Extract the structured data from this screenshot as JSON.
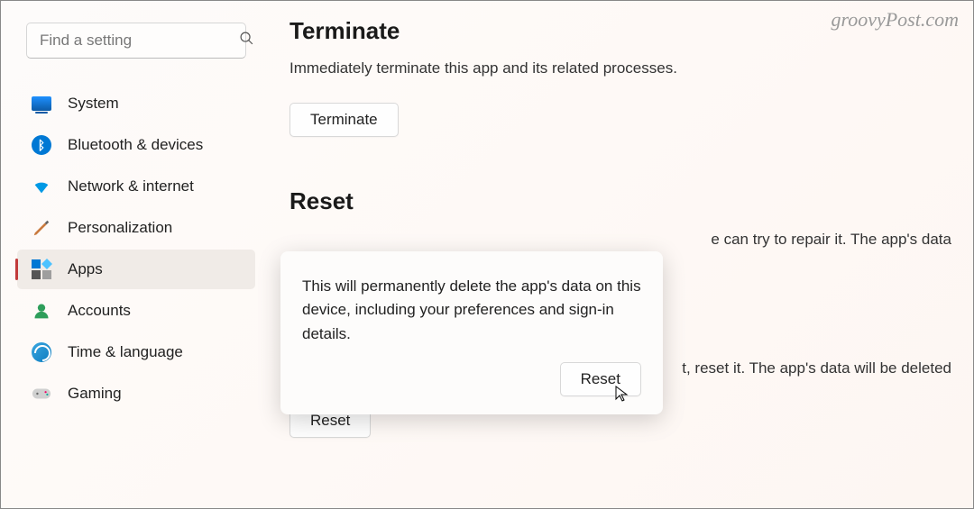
{
  "watermark": "groovyPost.com",
  "search": {
    "placeholder": "Find a setting"
  },
  "sidebar": {
    "items": [
      {
        "label": "System"
      },
      {
        "label": "Bluetooth & devices"
      },
      {
        "label": "Network & internet"
      },
      {
        "label": "Personalization"
      },
      {
        "label": "Apps"
      },
      {
        "label": "Accounts"
      },
      {
        "label": "Time & language"
      },
      {
        "label": "Gaming"
      }
    ]
  },
  "main": {
    "terminate": {
      "title": "Terminate",
      "desc": "Immediately terminate this app and its related processes.",
      "button": "Terminate"
    },
    "reset": {
      "title": "Reset",
      "repair_fragment": "e can try to repair it. The app's data",
      "reset_fragment": "t, reset it. The app's data will be deleted",
      "button": "Reset"
    }
  },
  "flyout": {
    "text": "This will permanently delete the app's data on this device, including your preferences and sign-in details.",
    "button": "Reset"
  }
}
